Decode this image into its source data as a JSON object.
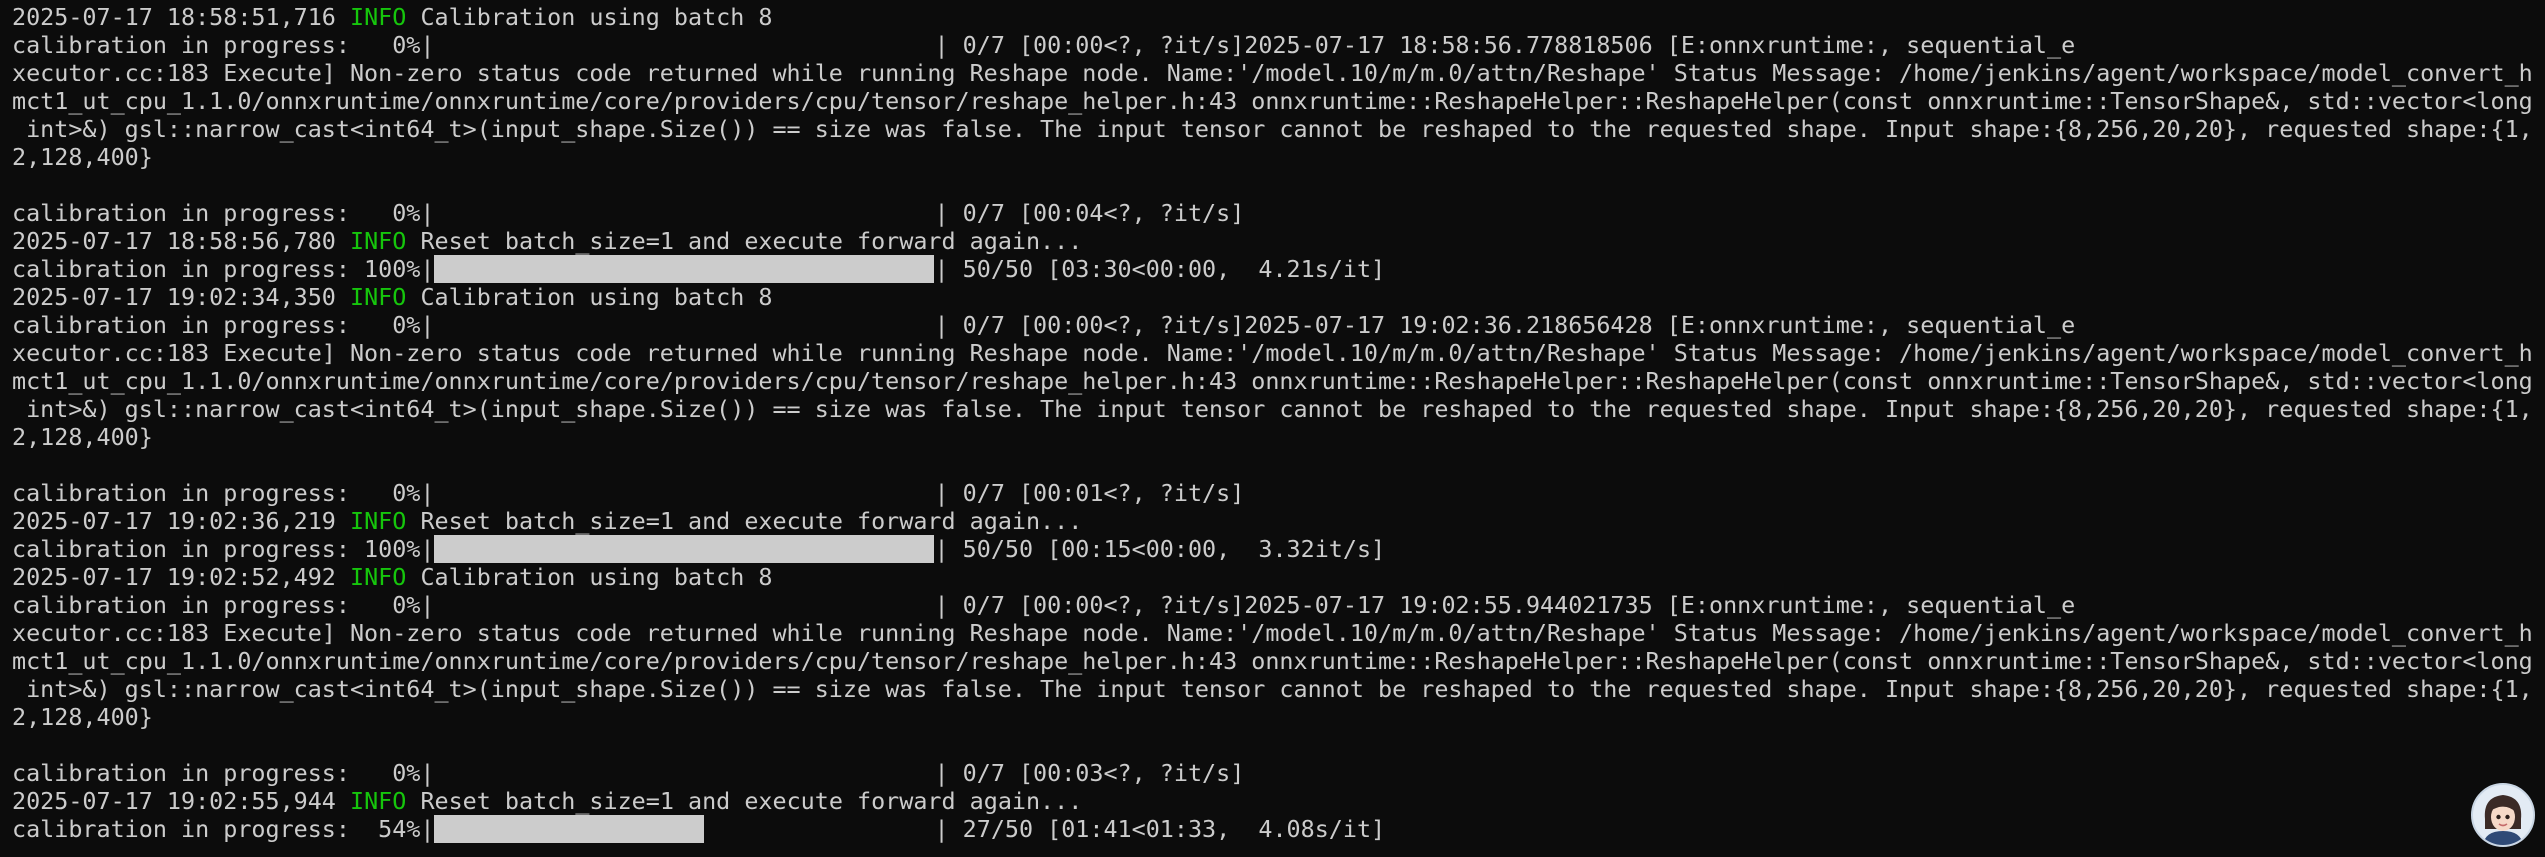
{
  "theme": {
    "background": "#0c0c0c",
    "foreground": "#cccccc",
    "info": "#16c60c"
  },
  "lines": [
    {
      "kind": "log",
      "ts": "2025-07-17 18:58:51,716",
      "level": "INFO",
      "msg": "Calibration using batch 8"
    },
    {
      "kind": "progress",
      "prefix": "calibration in progress:   0%|",
      "fill": 0,
      "suffix": "| 0/7 [00:00<?, ?it/s]2025-07-17 18:58:56.778818506 [E:onnxruntime:, sequential_e"
    },
    {
      "kind": "text",
      "text": "xecutor.cc:183 Execute] Non-zero status code returned while running Reshape node. Name:'/model.10/m/m.0/attn/Reshape' Status Message: /home/jenkins/agent/workspace/model_convert_h"
    },
    {
      "kind": "text",
      "text": "mct1_ut_cpu_1.1.0/onnxruntime/onnxruntime/core/providers/cpu/tensor/reshape_helper.h:43 onnxruntime::ReshapeHelper::ReshapeHelper(const onnxruntime::TensorShape&, std::vector<long"
    },
    {
      "kind": "text",
      "text": " int>&) gsl::narrow_cast<int64_t>(input_shape.Size()) == size was false. The input tensor cannot be reshaped to the requested shape. Input shape:{8,256,20,20}, requested shape:{1,"
    },
    {
      "kind": "text",
      "text": "2,128,400}"
    },
    {
      "kind": "text",
      "text": ""
    },
    {
      "kind": "progress",
      "prefix": "calibration in progress:   0%|",
      "fill": 0,
      "suffix": "| 0/7 [00:04<?, ?it/s]"
    },
    {
      "kind": "log",
      "ts": "2025-07-17 18:58:56,780",
      "level": "INFO",
      "msg": "Reset batch_size=1 and execute forward again..."
    },
    {
      "kind": "progress",
      "prefix": "calibration in progress: 100%|",
      "fill": 1,
      "suffix": "| 50/50 [03:30<00:00,  4.21s/it]"
    },
    {
      "kind": "log",
      "ts": "2025-07-17 19:02:34,350",
      "level": "INFO",
      "msg": "Calibration using batch 8"
    },
    {
      "kind": "progress",
      "prefix": "calibration in progress:   0%|",
      "fill": 0,
      "suffix": "| 0/7 [00:00<?, ?it/s]2025-07-17 19:02:36.218656428 [E:onnxruntime:, sequential_e"
    },
    {
      "kind": "text",
      "text": "xecutor.cc:183 Execute] Non-zero status code returned while running Reshape node. Name:'/model.10/m/m.0/attn/Reshape' Status Message: /home/jenkins/agent/workspace/model_convert_h"
    },
    {
      "kind": "text",
      "text": "mct1_ut_cpu_1.1.0/onnxruntime/onnxruntime/core/providers/cpu/tensor/reshape_helper.h:43 onnxruntime::ReshapeHelper::ReshapeHelper(const onnxruntime::TensorShape&, std::vector<long"
    },
    {
      "kind": "text",
      "text": " int>&) gsl::narrow_cast<int64_t>(input_shape.Size()) == size was false. The input tensor cannot be reshaped to the requested shape. Input shape:{8,256,20,20}, requested shape:{1,"
    },
    {
      "kind": "text",
      "text": "2,128,400}"
    },
    {
      "kind": "text",
      "text": ""
    },
    {
      "kind": "progress",
      "prefix": "calibration in progress:   0%|",
      "fill": 0,
      "suffix": "| 0/7 [00:01<?, ?it/s]"
    },
    {
      "kind": "log",
      "ts": "2025-07-17 19:02:36,219",
      "level": "INFO",
      "msg": "Reset batch_size=1 and execute forward again..."
    },
    {
      "kind": "progress",
      "prefix": "calibration in progress: 100%|",
      "fill": 1,
      "suffix": "| 50/50 [00:15<00:00,  3.32it/s]"
    },
    {
      "kind": "log",
      "ts": "2025-07-17 19:02:52,492",
      "level": "INFO",
      "msg": "Calibration using batch 8"
    },
    {
      "kind": "progress",
      "prefix": "calibration in progress:   0%|",
      "fill": 0,
      "suffix": "| 0/7 [00:00<?, ?it/s]2025-07-17 19:02:55.944021735 [E:onnxruntime:, sequential_e"
    },
    {
      "kind": "text",
      "text": "xecutor.cc:183 Execute] Non-zero status code returned while running Reshape node. Name:'/model.10/m/m.0/attn/Reshape' Status Message: /home/jenkins/agent/workspace/model_convert_h"
    },
    {
      "kind": "text",
      "text": "mct1_ut_cpu_1.1.0/onnxruntime/onnxruntime/core/providers/cpu/tensor/reshape_helper.h:43 onnxruntime::ReshapeHelper::ReshapeHelper(const onnxruntime::TensorShape&, std::vector<long"
    },
    {
      "kind": "text",
      "text": " int>&) gsl::narrow_cast<int64_t>(input_shape.Size()) == size was false. The input tensor cannot be reshaped to the requested shape. Input shape:{8,256,20,20}, requested shape:{1,"
    },
    {
      "kind": "text",
      "text": "2,128,400}"
    },
    {
      "kind": "text",
      "text": ""
    },
    {
      "kind": "progress",
      "prefix": "calibration in progress:   0%|",
      "fill": 0,
      "suffix": "| 0/7 [00:03<?, ?it/s]"
    },
    {
      "kind": "log",
      "ts": "2025-07-17 19:02:55,944",
      "level": "INFO",
      "msg": "Reset batch_size=1 and execute forward again..."
    },
    {
      "kind": "progress",
      "prefix": "calibration in progress:  54%|",
      "fill": 0.54,
      "suffix": "| 27/50 [01:41<01:33,  4.08s/it]"
    }
  ],
  "avatar": {
    "icon": "user-avatar-icon"
  }
}
